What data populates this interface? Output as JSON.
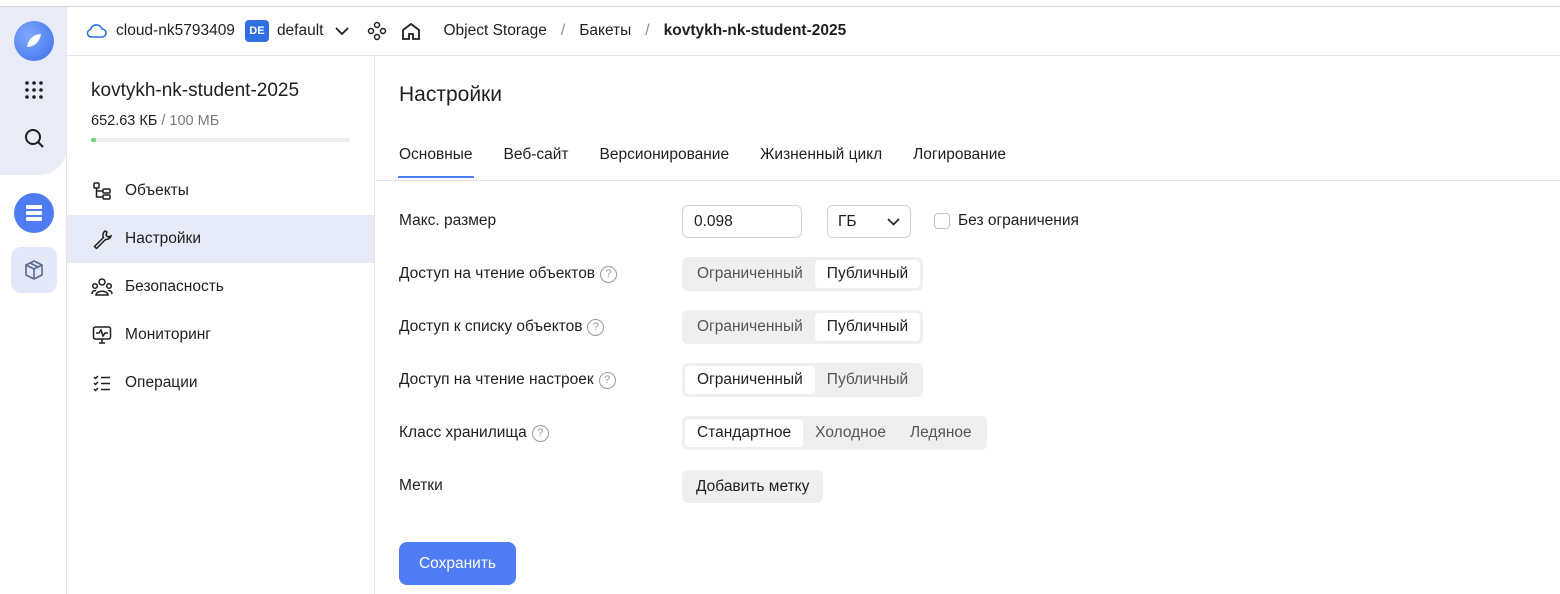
{
  "header": {
    "cloud_name": "cloud-nk5793409",
    "folder_badge": "DE",
    "folder_name": "default",
    "breadcrumbs": [
      "Object Storage",
      "Бакеты",
      "kovtykh-nk-student-2025"
    ],
    "separator": "/"
  },
  "sidebar": {
    "bucket_name": "kovtykh-nk-student-2025",
    "usage_used": "652.63 КБ",
    "usage_total": "/ 100 МБ",
    "usage_fraction": 0.0064,
    "items": [
      {
        "label": "Объекты",
        "icon": "tree-icon"
      },
      {
        "label": "Настройки",
        "icon": "wrench-icon",
        "active": true
      },
      {
        "label": "Безопасность",
        "icon": "users-icon"
      },
      {
        "label": "Мониторинг",
        "icon": "monitor-icon"
      },
      {
        "label": "Операции",
        "icon": "list-check-icon"
      }
    ]
  },
  "main": {
    "title": "Настройки",
    "tabs": [
      "Основные",
      "Веб-сайт",
      "Версионирование",
      "Жизненный цикл",
      "Логирование"
    ],
    "max_size": {
      "label": "Макс. размер",
      "value": "0.098",
      "unit": "ГБ",
      "unlimited_label": "Без ограничения",
      "unlimited_checked": false
    },
    "read_objects": {
      "label": "Доступ на чтение объектов",
      "options": [
        "Ограниченный",
        "Публичный"
      ],
      "selected": "Публичный"
    },
    "list_objects": {
      "label": "Доступ к списку объектов",
      "options": [
        "Ограниченный",
        "Публичный"
      ],
      "selected": "Публичный"
    },
    "read_settings": {
      "label": "Доступ на чтение настроек",
      "options": [
        "Ограниченный",
        "Публичный"
      ],
      "selected": "Ограниченный"
    },
    "storage_class": {
      "label": "Класс хранилища",
      "options": [
        "Стандартное",
        "Холодное",
        "Ледяное"
      ],
      "selected": "Стандартное"
    },
    "tags": {
      "label": "Метки",
      "add_label": "Добавить метку"
    },
    "save_label": "Сохранить",
    "help_glyph": "?"
  },
  "colors": {
    "accent": "#4f7cf3",
    "active_bg": "#e7ebf7",
    "usage_fill": "#6fcf7a",
    "badge": "#2f6fe0"
  }
}
